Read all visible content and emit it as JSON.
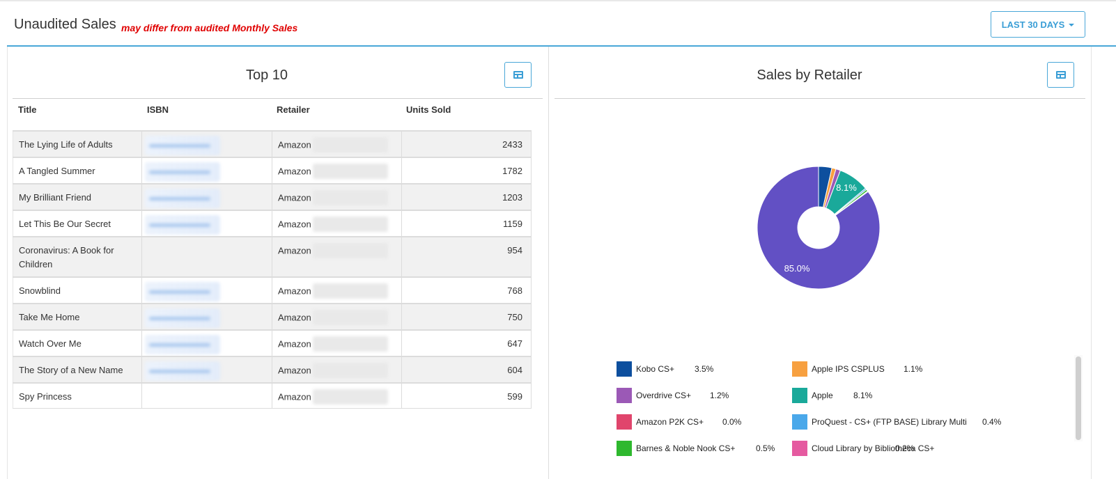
{
  "header": {
    "title": "Unaudited Sales",
    "note": "may differ from audited Monthly Sales",
    "period_label": "LAST 30 DAYS"
  },
  "top10": {
    "title": "Top 10",
    "columns": [
      "Title",
      "ISBN",
      "Retailer",
      "Units Sold"
    ],
    "rows": [
      {
        "title": "The Lying Life of Adults",
        "retailer": "Amazon",
        "units": "2433"
      },
      {
        "title": "A Tangled Summer",
        "retailer": "Amazon",
        "units": "1782"
      },
      {
        "title": "My Brilliant Friend",
        "retailer": "Amazon",
        "units": "1203"
      },
      {
        "title": "Let This Be Our Secret",
        "retailer": "Amazon",
        "units": "1159"
      },
      {
        "title": "Coronavirus: A Book for Children",
        "retailer": "Amazon",
        "units": "954"
      },
      {
        "title": "Snowblind",
        "retailer": "Amazon",
        "units": "768"
      },
      {
        "title": "Take Me Home",
        "retailer": "Amazon",
        "units": "750"
      },
      {
        "title": "Watch Over Me",
        "retailer": "Amazon",
        "units": "647"
      },
      {
        "title": "The Story of a New Name",
        "retailer": "Amazon",
        "units": "604"
      },
      {
        "title": "Spy Princess",
        "retailer": "Amazon",
        "units": "599"
      }
    ]
  },
  "sales_by_retailer": {
    "title": "Sales by Retailer",
    "labels": {
      "apple": "8.1%",
      "overdrive": "85.0%"
    },
    "legend": [
      {
        "name": "Kobo CS+",
        "pct": "3.5%",
        "color": "#0d4f9e"
      },
      {
        "name": "Apple IPS CSPLUS",
        "pct": "1.1%",
        "color": "#f7a040"
      },
      {
        "name": "Overdrive CS+",
        "pct": "1.2%",
        "color": "#9b59b6"
      },
      {
        "name": "Apple",
        "pct": "8.1%",
        "color": "#1aa99a"
      },
      {
        "name": "Amazon P2K CS+",
        "pct": "0.0%",
        "color": "#e0456c"
      },
      {
        "name": "ProQuest - CS+ (FTP BASE) Library Multi",
        "pct": "0.4%",
        "color": "#4aa8ea"
      },
      {
        "name": "Barnes & Noble Nook CS+",
        "pct": "0.5%",
        "color": "#2eb82e"
      },
      {
        "name": "Cloud Library by Bibliotheca CS+",
        "pct": "0.2%",
        "color": "#e55aa0"
      }
    ]
  },
  "chart_data": {
    "type": "pie",
    "title": "Sales by Retailer",
    "slices": [
      {
        "name": "Kobo CS+",
        "value": 3.5,
        "color": "#0d4f9e"
      },
      {
        "name": "Apple IPS CSPLUS",
        "value": 1.1,
        "color": "#f7a040"
      },
      {
        "name": "Overdrive CS+",
        "value": 1.2,
        "color": "#9b59b6"
      },
      {
        "name": "Apple",
        "value": 8.1,
        "color": "#1aa99a"
      },
      {
        "name": "Amazon P2K CS+",
        "value": 0.0,
        "color": "#e0456c"
      },
      {
        "name": "ProQuest - CS+ (FTP BASE) Library Multi",
        "value": 0.4,
        "color": "#4aa8ea"
      },
      {
        "name": "Barnes & Noble Nook CS+",
        "value": 0.5,
        "color": "#2eb82e"
      },
      {
        "name": "Cloud Library by Bibliotheca CS+",
        "value": 0.2,
        "color": "#e55aa0"
      },
      {
        "value": 85.0,
        "color": "#6250c4"
      }
    ],
    "donut": true
  }
}
